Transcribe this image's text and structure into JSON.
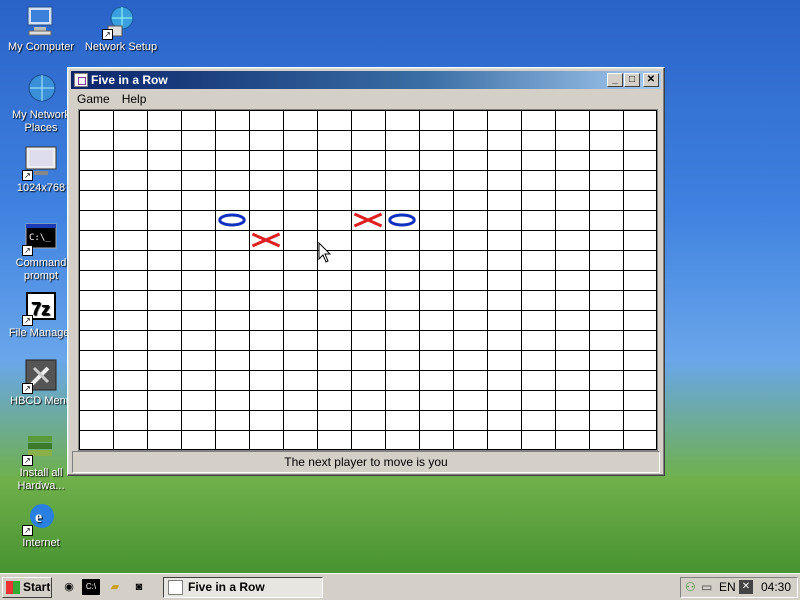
{
  "desktop": {
    "icons": [
      {
        "label": "My Computer",
        "icon": "computer-icon"
      },
      {
        "label": "Network Setup",
        "icon": "network-icon"
      },
      {
        "label": "My Network Places",
        "icon": "network-places-icon"
      },
      {
        "label": "1024x768",
        "icon": "monitor-icon"
      },
      {
        "label": "Command prompt",
        "icon": "command-prompt-icon"
      },
      {
        "label": "File Manager",
        "icon": "7zip-icon"
      },
      {
        "label": "HBCD Menu",
        "icon": "tools-icon"
      },
      {
        "label": "Install all Hardwa...",
        "icon": "install-icon"
      },
      {
        "label": "Internet",
        "icon": "internet-icon"
      }
    ]
  },
  "window": {
    "title": "Five in a Row",
    "menu": [
      "Game",
      "Help"
    ],
    "status": "The next player to move is you",
    "colors": {
      "x": "#e02020",
      "o": "#1030c0"
    },
    "board": {
      "cols": 17,
      "rows": 17,
      "pieces": [
        {
          "row": 5,
          "col": 4,
          "mark": "O"
        },
        {
          "row": 5,
          "col": 8,
          "mark": "X"
        },
        {
          "row": 5,
          "col": 9,
          "mark": "O"
        },
        {
          "row": 6,
          "col": 5,
          "mark": "X"
        }
      ]
    }
  },
  "taskbar": {
    "start_label": "Start",
    "task_label": "Five in a Row",
    "lang": "EN",
    "clock": "04:30"
  }
}
